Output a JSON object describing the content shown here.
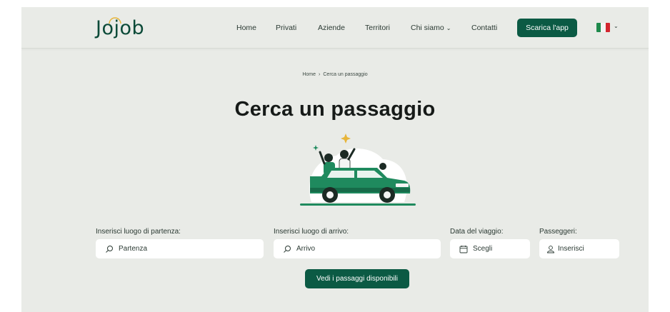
{
  "header": {
    "logo_text": "Jojob",
    "nav": [
      {
        "label": "Home"
      },
      {
        "label": "Privati"
      },
      {
        "label": "Aziende"
      },
      {
        "label": "Territori"
      },
      {
        "label": "Chi siamo"
      },
      {
        "label": "Contatti"
      }
    ],
    "app_button": "Scarica l'app",
    "language_flag_icon": "italy-flag-icon"
  },
  "breadcrumb": {
    "home": "Home",
    "separator": "›",
    "current": "Cerca un passaggio"
  },
  "page_title": "Cerca un passaggio",
  "illustration_icon": "car-with-passengers-illustration",
  "form": {
    "departure": {
      "label": "Inserisci luogo di partenza:",
      "placeholder": "Partenza"
    },
    "arrival": {
      "label": "Inserisci luogo di arrivo:",
      "placeholder": "Arrivo"
    },
    "date": {
      "label": "Data del viaggio:",
      "placeholder": "Scegli"
    },
    "passengers": {
      "label": "Passeggeri:",
      "placeholder": "Inserisci"
    },
    "submit": "Vedi i passaggi disponibili"
  },
  "colors": {
    "brand": "#0b5a44",
    "background": "#e9ebe7",
    "car": "#1f8a5e"
  }
}
